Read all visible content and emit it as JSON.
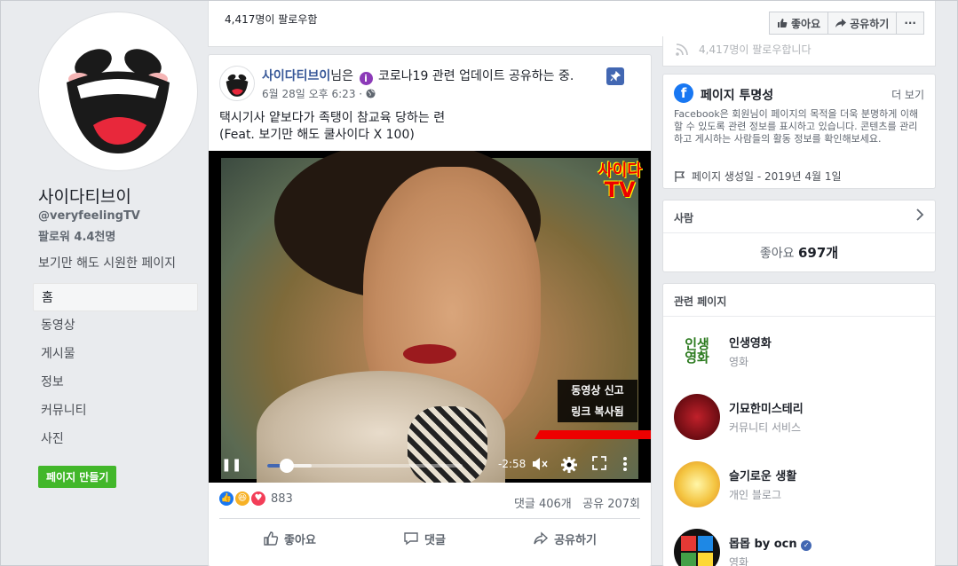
{
  "left": {
    "page_name": "사이다티브이",
    "handle": "@veryfeelingTV",
    "followers": "팔로워 4.4천명",
    "description": "보기만 해도 시원한 페이지",
    "nav": [
      "홈",
      "동영상",
      "게시물",
      "정보",
      "커뮤니티",
      "사진"
    ],
    "create_page": "페이지 만들기"
  },
  "top": {
    "followers": "4,417명이 팔로우함",
    "like": "좋아요",
    "share": "공유하기",
    "more": "···"
  },
  "post": {
    "author": "사이다티브이",
    "author_suffix": "님은",
    "update": "코로나19 관련 업데이트 공유하는 중.",
    "info_glyph": "i",
    "time": "6월 28일 오후 6:23 ·",
    "text_line1": "택시기사 얕보다가 족탱이 참교육 당하는 련",
    "text_line2": "(Feat. 보기만 해도 쿨사이다 X 100)",
    "video": {
      "logo_line1": "사이다",
      "logo_line2": "TV",
      "menu": [
        "동영상 신고",
        "링크 복사됨"
      ],
      "time": "-2:58",
      "progress": 0.1
    },
    "reactions_count": "883",
    "comments": "댓글 406개",
    "shares": "공유 207회",
    "actions": [
      "좋아요",
      "댓글",
      "공유하기"
    ]
  },
  "right": {
    "faded_followers": "4,417명이 팔로우합니다",
    "transparency": {
      "title": "페이지 투명성",
      "more": "더 보기",
      "desc": "Facebook은 회원님이 페이지의 목적을 더욱 분명하게 이해할 수 있도록 관련 정보를 표시하고 있습니다. 콘텐츠를 관리하고 게시하는 사람들의 활동 정보를 확인해보세요.",
      "created": "페이지 생성일 - 2019년 4월 1일"
    },
    "people": {
      "title": "사람",
      "likes_label": "좋아요",
      "likes_count": "697개"
    },
    "related": {
      "title": "관련 페이지",
      "items": [
        {
          "name": "인생영화",
          "sub": "영화",
          "logo": "인생영화"
        },
        {
          "name": "기묘한미스테리",
          "sub": "커뮤니티 서비스",
          "logo": ""
        },
        {
          "name": "슬기로운 생활",
          "sub": "개인 블로그",
          "logo": ""
        },
        {
          "name": "몹몹 by ocn",
          "sub": "영화",
          "logo": ""
        }
      ]
    }
  },
  "colors": {
    "brand": "#4267b2",
    "green": "#42b72a",
    "link": "#385898"
  }
}
